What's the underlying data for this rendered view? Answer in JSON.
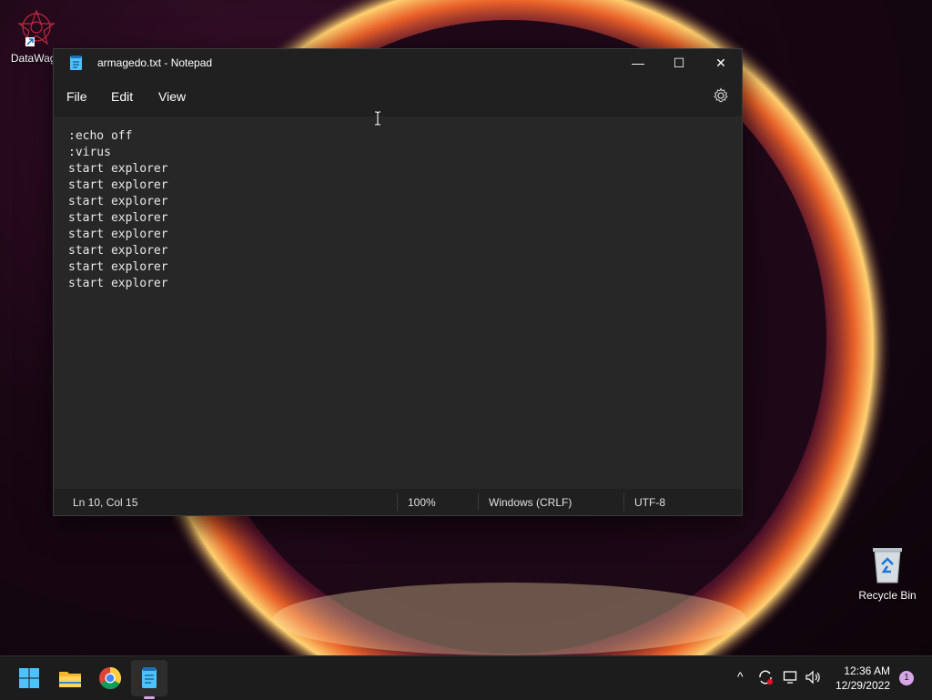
{
  "desktop": {
    "icons": [
      {
        "label": "DataWago"
      },
      {
        "label": "Recycle Bin"
      }
    ]
  },
  "notepad": {
    "title": "armagedo.txt - Notepad",
    "controls": {
      "minimize": "—",
      "maximize": "☐",
      "close": "✕"
    },
    "menu": [
      "File",
      "Edit",
      "View"
    ],
    "lines": [
      ":echo off",
      ":virus",
      "start explorer",
      "start explorer",
      "start explorer",
      "start explorer",
      "start explorer",
      "start explorer",
      "start explorer",
      "start explorer"
    ],
    "status": {
      "position": "Ln 10, Col 15",
      "zoom": "100%",
      "line_ending": "Windows (CRLF)",
      "encoding": "UTF-8"
    }
  },
  "taskbar": {
    "apps": [
      "start-button",
      "file-explorer",
      "chrome",
      "notepad"
    ],
    "tray": {
      "chevron": "^"
    },
    "time": "12:36 AM",
    "date": "12/29/2022",
    "notifications": "1"
  },
  "colors": {
    "accent": "#4cc2ff",
    "window_bg": "#272727",
    "chrome_bg": "#202020"
  }
}
